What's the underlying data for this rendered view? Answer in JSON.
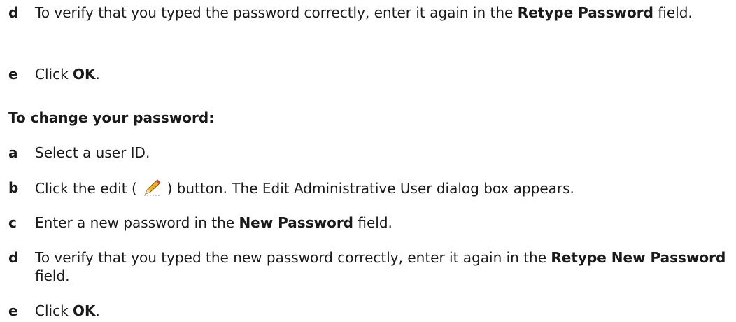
{
  "steps_top": [
    {
      "letter": "d",
      "pre": "To verify that you typed the password correctly, enter it again in the ",
      "bold": "Retype Password",
      "post": " field."
    },
    {
      "letter": "e",
      "pre": "Click ",
      "bold": "OK",
      "post": "."
    }
  ],
  "section_heading": "To change your password:",
  "steps": [
    {
      "letter": "a",
      "text": "Select a user ID."
    },
    {
      "letter": "b",
      "pre": "Click the edit (",
      "post": ") button. The Edit Administrative User dialog box appears.",
      "icon": "pencil-edit-icon"
    },
    {
      "letter": "c",
      "pre": "Enter a new password in the ",
      "bold": "New Password",
      "post": " field."
    },
    {
      "letter": "d",
      "pre": "To verify that you typed the new password correctly, enter it again in the ",
      "bold": "Retype New Password",
      "post": " field."
    },
    {
      "letter": "e",
      "pre": "Click ",
      "bold": "OK",
      "post": "."
    }
  ]
}
